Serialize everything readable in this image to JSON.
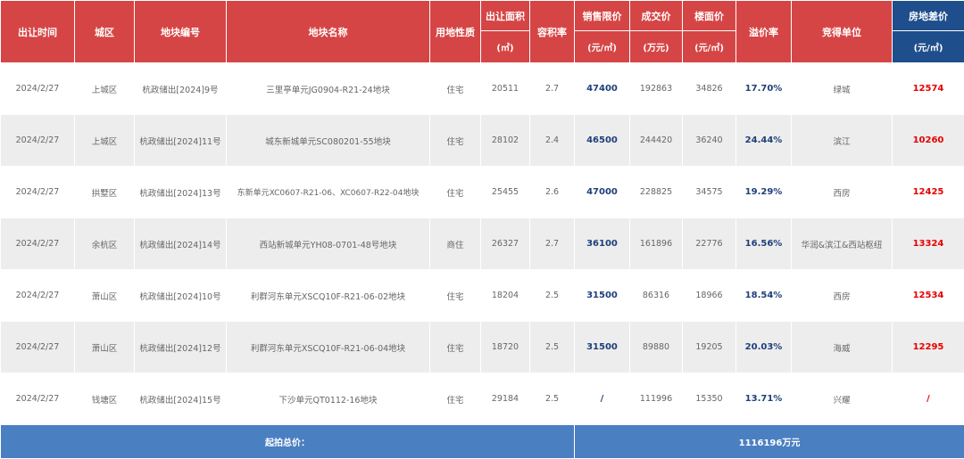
{
  "header": {
    "date": "出让时间",
    "district": "城区",
    "plot_no": "地块编号",
    "plot_name": "地块名称",
    "land_use": "用地性质",
    "area": "出让面积",
    "area_unit": "(㎡)",
    "far": "容积率",
    "limit_price": "销售限价",
    "limit_price_unit": "(元/㎡)",
    "deal_price": "成交价",
    "deal_price_unit": "(万元)",
    "floor_price": "楼面价",
    "floor_price_unit": "(元/㎡)",
    "premium": "溢价率",
    "winner": "竞得单位",
    "diff": "房地差价",
    "diff_unit": "(元/㎡)"
  },
  "rows": [
    {
      "date": "2024/2/27",
      "district": "上城区",
      "plot_no": "杭政储出[2024]9号",
      "plot_name": "三里亭单元JG0904-R21-24地块",
      "land_use": "住宅",
      "area": "20511",
      "far": "2.7",
      "limit_price": "47400",
      "deal_price": "192863",
      "floor_price": "34826",
      "premium": "17.70%",
      "winner": "绿城",
      "diff": "12574"
    },
    {
      "date": "2024/2/27",
      "district": "上城区",
      "plot_no": "杭政储出[2024]11号",
      "plot_name": "城东新城单元SC080201-55地块",
      "land_use": "住宅",
      "area": "28102",
      "far": "2.4",
      "limit_price": "46500",
      "deal_price": "244420",
      "floor_price": "36240",
      "premium": "24.44%",
      "winner": "滨江",
      "diff": "10260"
    },
    {
      "date": "2024/2/27",
      "district": "拱墅区",
      "plot_no": "杭政储出[2024]13号",
      "plot_name": "东新单元XC0607-R21-06、XC0607-R22-04地块",
      "land_use": "住宅",
      "area": "25455",
      "far": "2.6",
      "limit_price": "47000",
      "deal_price": "228825",
      "floor_price": "34575",
      "premium": "19.29%",
      "winner": "西房",
      "diff": "12425"
    },
    {
      "date": "2024/2/27",
      "district": "余杭区",
      "plot_no": "杭政储出[2024]14号",
      "plot_name": "西站新城单元YH08-0701-48号地块",
      "land_use": "商住",
      "area": "26327",
      "far": "2.7",
      "limit_price": "36100",
      "deal_price": "161896",
      "floor_price": "22776",
      "premium": "16.56%",
      "winner": "华润&滨江&西站枢纽",
      "diff": "13324"
    },
    {
      "date": "2024/2/27",
      "district": "萧山区",
      "plot_no": "杭政储出[2024]10号",
      "plot_name": "利群河东单元XSCQ10F-R21-06-02地块",
      "land_use": "住宅",
      "area": "18204",
      "far": "2.5",
      "limit_price": "31500",
      "deal_price": "86316",
      "floor_price": "18966",
      "premium": "18.54%",
      "winner": "西房",
      "diff": "12534"
    },
    {
      "date": "2024/2/27",
      "district": "萧山区",
      "plot_no": "杭政储出[2024]12号",
      "plot_name": "利群河东单元XSCQ10F-R21-06-04地块",
      "land_use": "住宅",
      "area": "18720",
      "far": "2.5",
      "limit_price": "31500",
      "deal_price": "89880",
      "floor_price": "19205",
      "premium": "20.03%",
      "winner": "海威",
      "diff": "12295"
    },
    {
      "date": "2024/2/27",
      "district": "钱塘区",
      "plot_no": "杭政储出[2024]15号",
      "plot_name": "下沙单元QT0112-16地块",
      "land_use": "住宅",
      "area": "29184",
      "far": "2.5",
      "limit_price": "/",
      "deal_price": "111996",
      "floor_price": "15350",
      "premium": "13.71%",
      "winner": "兴耀",
      "diff": "/"
    }
  ],
  "footer": {
    "label": "起拍总价：",
    "total": "1116196万元"
  },
  "colors": {
    "header_red": "#d64545",
    "header_navy": "#1f4e8c",
    "footer_blue": "#4a7fc1",
    "value_blue": "#1f3f7a",
    "value_red": "#e60000"
  }
}
